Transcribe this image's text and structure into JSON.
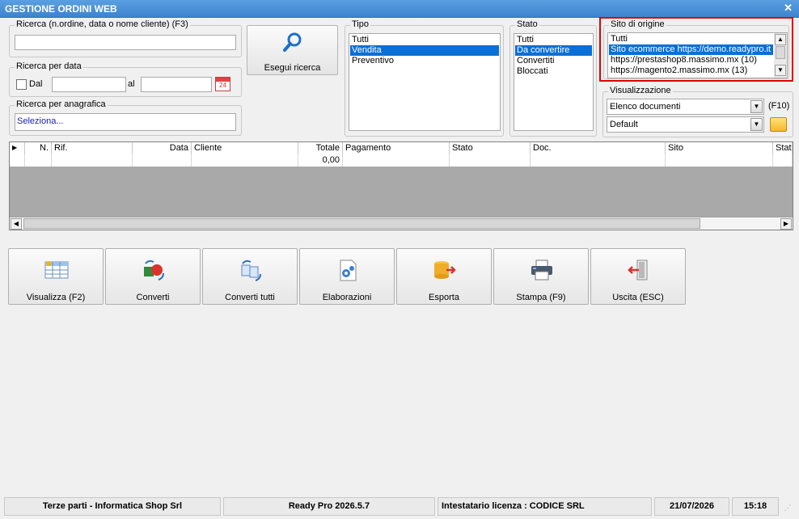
{
  "window": {
    "title": "GESTIONE ORDINI WEB"
  },
  "search": {
    "group_label": "Ricerca (n.ordine, data o nome cliente) (F3)",
    "value": ""
  },
  "date_search": {
    "group_label": "Ricerca per data",
    "dal_label": "Dal",
    "al_label": "al",
    "from": "",
    "to": "",
    "calendar_day": "24"
  },
  "anag": {
    "group_label": "Ricerca per anagrafica",
    "value": "Seleziona..."
  },
  "search_button": {
    "label": "Esegui ricerca"
  },
  "tipo": {
    "label": "Tipo",
    "items": [
      "Tutti",
      "Vendita",
      "Preventivo"
    ],
    "selected": "Vendita"
  },
  "stato": {
    "label": "Stato",
    "items": [
      "Tutti",
      "Da convertire",
      "Convertiti",
      "Bloccati"
    ],
    "selected": "Da convertire"
  },
  "sito": {
    "label": "Sito di origine",
    "items": [
      "Tutti",
      "Sito ecommerce https://demo.readypro.it",
      "https://prestashop8.massimo.mx (10)",
      "https://magento2.massimo.mx (13)"
    ],
    "selected": "Sito ecommerce https://demo.readypro.it"
  },
  "visual": {
    "label": "Visualizzazione",
    "combo1": "Elenco documenti",
    "shortcut": "(F10)",
    "combo2": "Default"
  },
  "table": {
    "columns": [
      "N.",
      "Rif.",
      "Data",
      "Cliente",
      "Totale",
      "Pagamento",
      "Stato",
      "Doc.",
      "Sito",
      "Stat"
    ],
    "total": "0,00"
  },
  "actions": [
    "Visualizza (F2)",
    "Converti",
    "Converti tutti",
    "Elaborazioni",
    "Esporta",
    "Stampa (F9)",
    "Uscita (ESC)"
  ],
  "statusbar": {
    "company": "Terze parti - Informatica Shop Srl",
    "version": "Ready Pro 2026.5.7",
    "license": "Intestatario licenza : CODICE SRL",
    "date": "21/07/2026",
    "time": "15:18"
  },
  "colors": {
    "title_bar": "#3d84cf",
    "selection": "#0a6fd6",
    "highlight_frame": "#e00000"
  }
}
